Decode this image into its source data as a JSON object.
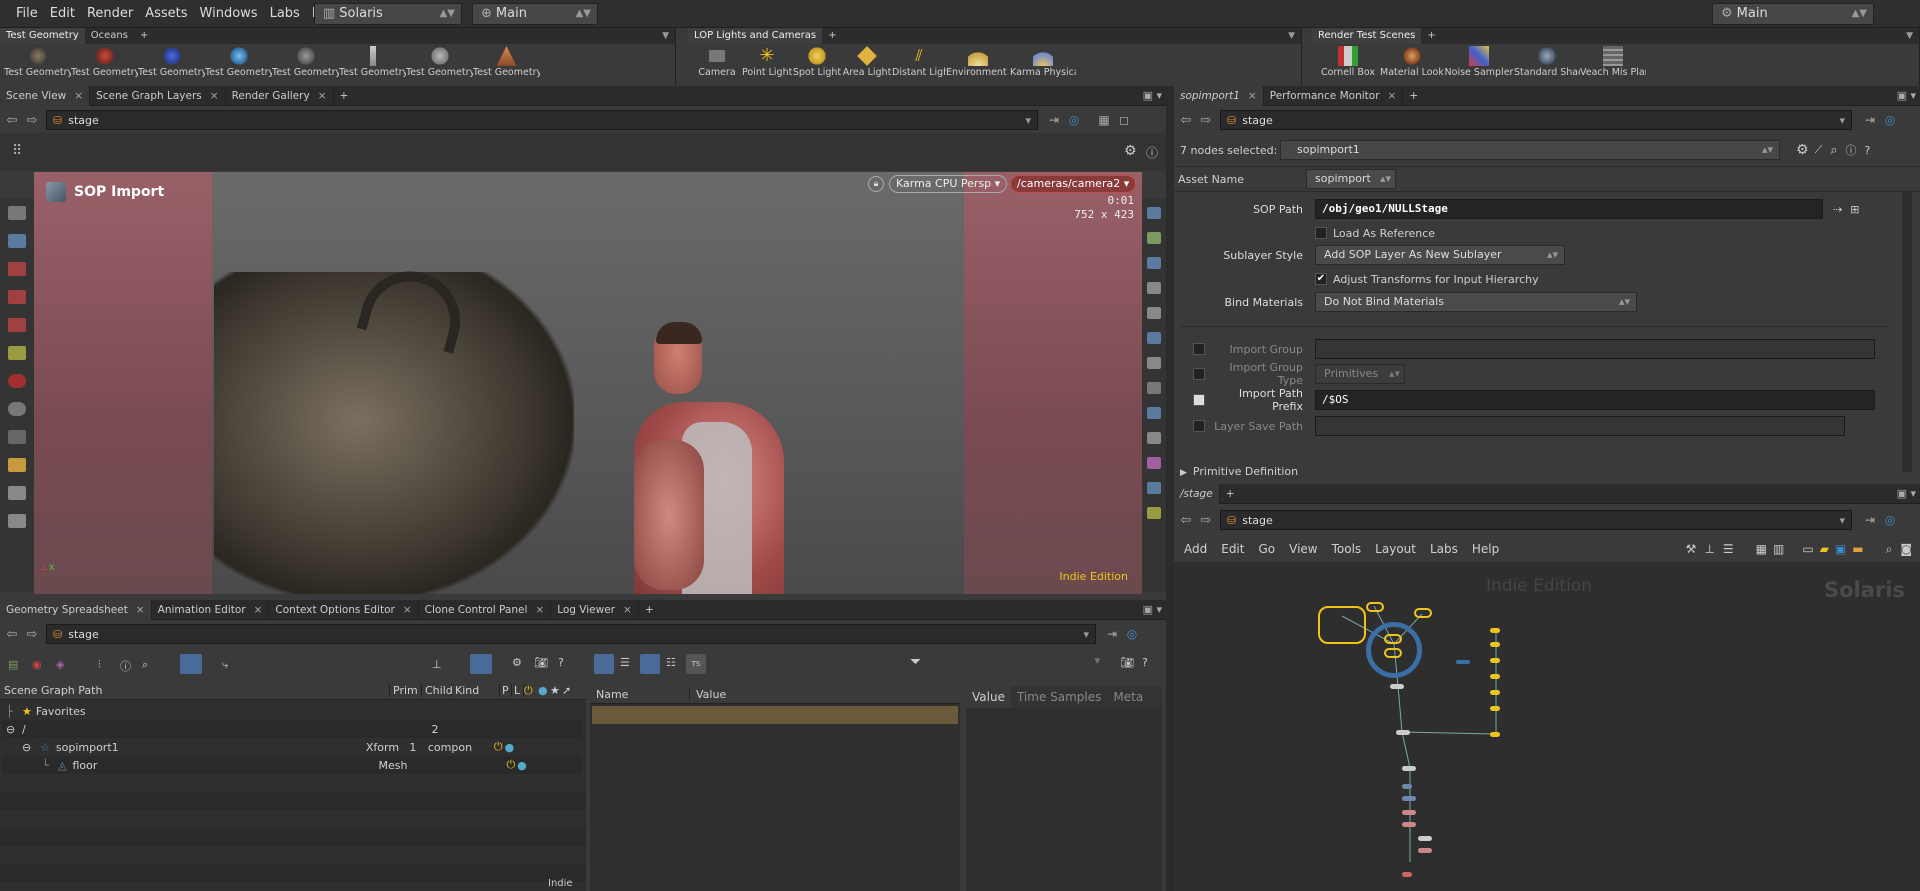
{
  "menubar": {
    "items": [
      "File",
      "Edit",
      "Render",
      "Assets",
      "Windows",
      "Labs",
      "Help"
    ],
    "desktop": "Solaris",
    "network": "Main",
    "right_network": "Main"
  },
  "shelves": {
    "left": {
      "tabs": [
        "Test Geometry",
        "Oceans"
      ],
      "tools": [
        "Test Geometry: C...",
        "Test Geometry: P...",
        "Test Geometry: R...",
        "Test Geometry: S...",
        "Test Geometry: S...",
        "Test Geometry: T...",
        "Test Geometry: T...",
        "Test Geometry: T..."
      ]
    },
    "middle": {
      "tabs": [
        "LOP Lights and Cameras"
      ],
      "tools": [
        "Camera",
        "Point Light",
        "Spot Light",
        "Area Light",
        "Distant Light",
        "Environment Light",
        "Karma Physical Sky..."
      ]
    },
    "right": {
      "tabs": [
        "Render Test Scenes"
      ],
      "tools": [
        "Cornell Box",
        "Material Lookdev",
        "Noise Sampler",
        "Standard Shader Ball",
        "Veach Mis Planks"
      ]
    }
  },
  "scene_view": {
    "tabs": [
      "Scene View",
      "Scene Graph Layers",
      "Render Gallery"
    ],
    "path": "stage",
    "title": "SOP Import",
    "renderer": "Karma CPU",
    "projection": "Persp",
    "camera": "/cameras/camera2",
    "time": "0:01",
    "resolution": "752 x 423",
    "watermark": "Indie Edition"
  },
  "bottom_left": {
    "tabs": [
      "Geometry Spreadsheet",
      "Animation Editor",
      "Context Options Editor",
      "Clone Control Panel",
      "Log Viewer"
    ],
    "path": "stage",
    "columns": [
      "Scene Graph Path",
      "Prim",
      "Child",
      "Kind",
      "P",
      "L"
    ],
    "rows": [
      {
        "name": "Favorites",
        "prim": "",
        "child": "",
        "kind": ""
      },
      {
        "name": "/",
        "prim": "",
        "child": "2",
        "kind": ""
      },
      {
        "name": "sopimport1",
        "prim": "Xform",
        "child": "1",
        "kind": "compon"
      },
      {
        "name": "floor",
        "prim": "Mesh",
        "child": "",
        "kind": ""
      }
    ],
    "detail_columns": [
      "Name",
      "Value"
    ],
    "detail_tabs": [
      "Value",
      "Time Samples",
      "Meta"
    ],
    "footer": "Indie"
  },
  "params": {
    "tabs": [
      "sopimport1",
      "Performance Monitor"
    ],
    "path": "stage",
    "selection_label": "7 nodes selected:",
    "selection_value": "sopimport1",
    "asset_name_label": "Asset Name",
    "asset_name_value": "sopimport",
    "sop_path_label": "SOP Path",
    "sop_path_value": "/obj/geo1/NULLStage",
    "load_as_reference": "Load As Reference",
    "sublayer_style_label": "Sublayer Style",
    "sublayer_style_value": "Add SOP Layer As New Sublayer",
    "adjust_transforms": "Adjust Transforms for Input Hierarchy",
    "bind_materials_label": "Bind Materials",
    "bind_materials_value": "Do Not Bind Materials",
    "import_group_label": "Import Group",
    "import_group_type_label": "Import Group Type",
    "import_group_type_value": "Primitives",
    "import_path_prefix_label": "Import Path Prefix",
    "import_path_prefix_value": "/$OS",
    "layer_save_path_label": "Layer Save Path",
    "primitive_definition": "Primitive Definition"
  },
  "network": {
    "tabs": [
      "/stage"
    ],
    "path": "stage",
    "menu": [
      "Add",
      "Edit",
      "Go",
      "View",
      "Tools",
      "Layout",
      "Labs",
      "Help"
    ],
    "watermark": "Indie Edition",
    "context": "Solaris"
  },
  "colors": {
    "accent_yellow": "#f0c419",
    "camera_red": "#8b3a3a",
    "node_blue": "#3a6ea5"
  }
}
